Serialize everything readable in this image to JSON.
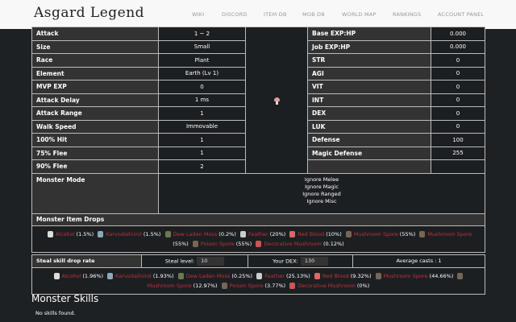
{
  "header": {
    "logo": "Asgard Legend",
    "nav": [
      "WIKI",
      "DISCORD",
      "ITEM DB",
      "MOB DB",
      "WORLD MAP",
      "RANKINGS",
      "ACCOUNT PANEL"
    ]
  },
  "left_stats": [
    [
      "Attack",
      "1 ~ 2"
    ],
    [
      "Size",
      "Small"
    ],
    [
      "Race",
      "Plant"
    ],
    [
      "Element",
      "Earth (Lv 1)"
    ],
    [
      "MVP EXP",
      "0"
    ],
    [
      "Attack Delay",
      "1 ms"
    ],
    [
      "Attack Range",
      "1"
    ],
    [
      "Walk Speed",
      "Immovable"
    ],
    [
      "100% Hit",
      "1"
    ],
    [
      "75% Flee",
      "1"
    ],
    [
      "90% Flee",
      "2"
    ]
  ],
  "right_stats": [
    [
      "Base EXP:HP",
      "0.000"
    ],
    [
      "Job EXP:HP",
      "0.000"
    ],
    [
      "STR",
      "0"
    ],
    [
      "AGI",
      "0"
    ],
    [
      "VIT",
      "0"
    ],
    [
      "INT",
      "0"
    ],
    [
      "DEX",
      "0"
    ],
    [
      "LUK",
      "0"
    ],
    [
      "Defense",
      "100"
    ],
    [
      "Magic Defense",
      "255"
    ],
    [
      "",
      ""
    ]
  ],
  "mode": {
    "label": "Monster Mode",
    "values": [
      "Ignore Melee",
      "Ignore Magic",
      "Ignore Ranged",
      "Ignore Misc"
    ]
  },
  "drops": {
    "label": "Monster Item Drops",
    "items": [
      {
        "name": "Alcohol",
        "rate": "(1.5%)",
        "icon": "#ddd"
      },
      {
        "name": "Karvodailnirol",
        "rate": "(1.5%)",
        "icon": "#8ab"
      },
      {
        "name": "Dew Laden Moss",
        "rate": "(0.2%)",
        "icon": "#6a7a4a"
      },
      {
        "name": "Feather",
        "rate": "(20%)",
        "icon": "#ccc"
      },
      {
        "name": "Red Blood",
        "rate": "(10%)",
        "icon": "#d66"
      },
      {
        "name": "Mushroom Spore",
        "rate": "(55%)",
        "icon": "#776655"
      },
      {
        "name": "Mushroom Spore",
        "rate": "(55%)",
        "icon": "#776655"
      },
      {
        "name": "Poison Spore",
        "rate": "(55%)",
        "icon": "#776655"
      },
      {
        "name": "Decorative Mushroom",
        "rate": "(0.12%)",
        "icon": "#c55"
      }
    ]
  },
  "steal": {
    "label": "Steal skill drop rate",
    "steal_level_label": "Steal level:",
    "steal_level": "10",
    "dex_label": "Your DEX:",
    "dex": "130",
    "avg": "Average casts : 1",
    "items": [
      {
        "name": "Alcohol",
        "rate": "(1.96%)",
        "icon": "#ddd"
      },
      {
        "name": "Karvodailnirol",
        "rate": "(1.93%)",
        "icon": "#8ab"
      },
      {
        "name": "Dew Laden Moss",
        "rate": "(0.25%)",
        "icon": "#6a7a4a"
      },
      {
        "name": "Feather",
        "rate": "(25.13%)",
        "icon": "#ccc"
      },
      {
        "name": "Red Blood",
        "rate": "(9.32%)",
        "icon": "#d66"
      },
      {
        "name": "Mushroom Spore",
        "rate": "(44.66%)",
        "icon": "#776655"
      },
      {
        "name": "Mushroom Spore",
        "rate": "(12.97%)",
        "icon": "#776655"
      },
      {
        "name": "Poison Spore",
        "rate": "(3.77%)",
        "icon": "#776655"
      },
      {
        "name": "Decorative Mushroom",
        "rate": "(0%)",
        "icon": "#c55"
      }
    ]
  },
  "skills": {
    "title": "Monster Skills",
    "empty": "No skills found."
  }
}
